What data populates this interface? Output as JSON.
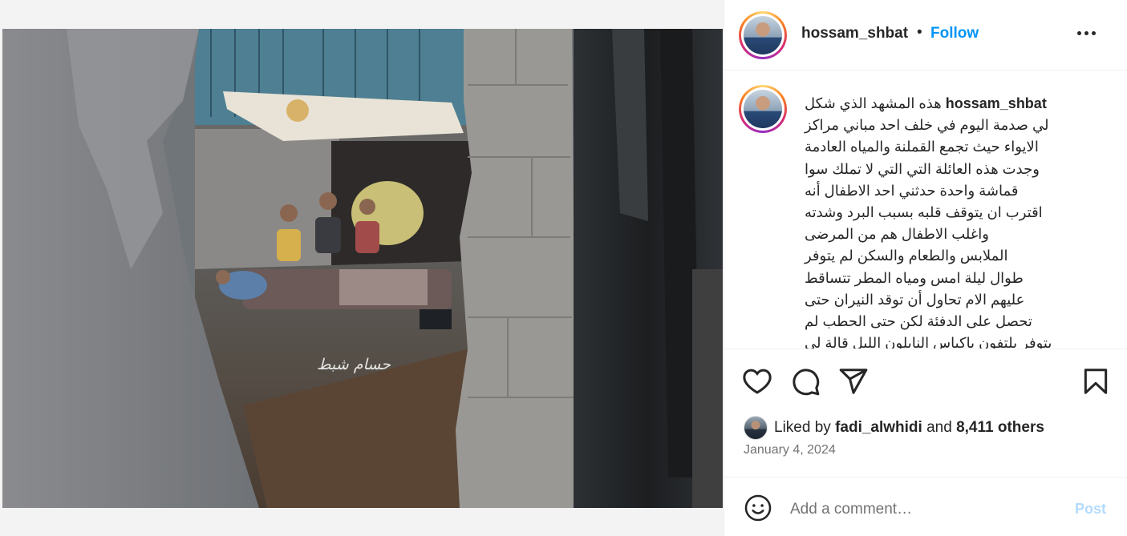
{
  "post": {
    "image_alt": "Photo of children sitting on the ground beside a shelter building, viewed through a broken concrete wall",
    "watermark": "حسام شبط"
  },
  "header": {
    "username": "hossam_shbat",
    "separator": "•",
    "follow_label": "Follow",
    "more_icon": "more-horizontal-icon"
  },
  "caption": {
    "username": "hossam_shbat",
    "lines": [
      "هذه المشهد الذي شكل",
      "لي صدمة اليوم في خلف احد مباني مراكز",
      "الايواء حيث تجمع القملنة والمياه العادمة",
      "وجدت هذه العائلة التي التي لا تملك سوا",
      "قماشة واحدة حدثني احد الاطفال أنه",
      "اقترب ان يتوقف قلبه بسبب البرد وشدته",
      "واغلب الاطفال هم من المرضى",
      "الملابس والطعام والسكن لم يتوفر",
      "طوال ليلة امس ومياه المطر تتساقط",
      "عليهم الام تحاول أن توقد النيران حتى",
      "تحصل على الدفئة لكن حتى الحطب لم",
      "يتوفر يلتفون باكياس النايلون الليل قالة لي"
    ]
  },
  "actions": {
    "like_icon": "heart-icon",
    "comment_icon": "comment-icon",
    "share_icon": "share-icon",
    "save_icon": "bookmark-icon"
  },
  "likes": {
    "prefix": "Liked by",
    "liker": "fadi_alwhidi",
    "connector": "and",
    "others": "8,411 others"
  },
  "date": "January 4, 2024",
  "comment": {
    "emoji_icon": "emoji-icon",
    "placeholder": "Add a comment…",
    "post_label": "Post"
  },
  "colors": {
    "link_blue": "#0095f6",
    "post_disabled": "#b3dbff",
    "text": "#262626",
    "muted": "#737373"
  }
}
